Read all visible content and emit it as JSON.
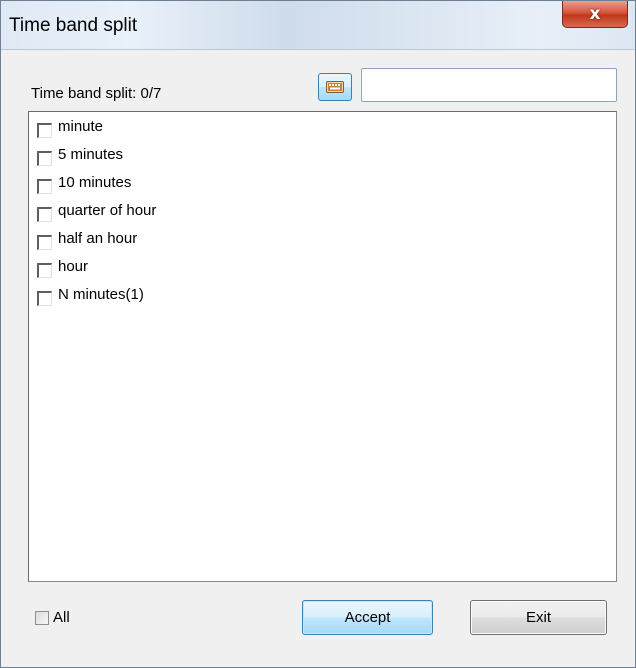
{
  "window": {
    "title": "Time band split",
    "close_glyph": "x"
  },
  "header": {
    "label": "Time band split: 0/7",
    "keyboard_icon": "keyboard-icon",
    "search_value": "",
    "search_placeholder": ""
  },
  "list": {
    "items": [
      {
        "label": "minute",
        "checked": false
      },
      {
        "label": "5 minutes",
        "checked": false
      },
      {
        "label": "10 minutes",
        "checked": false
      },
      {
        "label": "quarter of hour",
        "checked": false
      },
      {
        "label": "half an hour",
        "checked": false
      },
      {
        "label": "hour",
        "checked": false
      },
      {
        "label": "N minutes(1)",
        "checked": false
      }
    ]
  },
  "footer": {
    "all_label": "All",
    "all_checked": false,
    "accept_label": "Accept",
    "exit_label": "Exit"
  },
  "colors": {
    "accent_button_border": "#3c7fb1",
    "close_button_red": "#c2371c"
  }
}
